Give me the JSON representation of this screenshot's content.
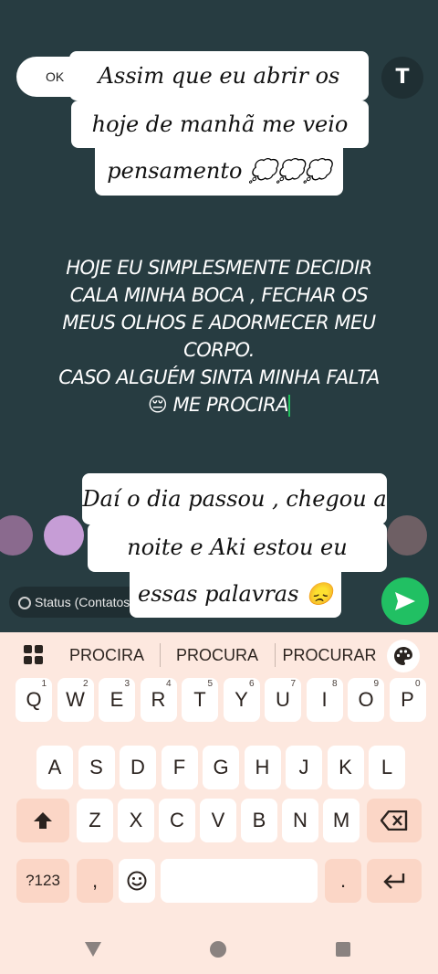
{
  "editor": {
    "ok_label": "OK",
    "text_tool_label": "T",
    "sticker_top": [
      "Assim que eu abrir os olhos",
      "hoje de manhã me veio esse",
      "pensamento 💭💭💭"
    ],
    "main_text": [
      "HOJE EU SIMPLESMENTE DECIDIR",
      "CALA MINHA BOCA , FECHAR OS",
      "MEUS OLHOS E ADORMECER MEU",
      "CORPO.",
      "CASO ALGUÉM SINTA MINHA FALTA",
      "😔 ME PROCIRA"
    ],
    "sticker_bottom": [
      "Daí o dia passou , chegou a",
      "noite e Aki estou eu digitando",
      "essas palavras 😞"
    ],
    "swatch_colors": [
      "#8a6a8e",
      "#c69dd6",
      "#6e5f64"
    ],
    "status_label": "Status (Contatos)",
    "accent": "#21c063"
  },
  "keyboard": {
    "suggestions": [
      "PROCIRA",
      "PROCURA",
      "PROCURAR"
    ],
    "row1": [
      {
        "k": "Q",
        "h": "1"
      },
      {
        "k": "W",
        "h": "2"
      },
      {
        "k": "E",
        "h": "3"
      },
      {
        "k": "R",
        "h": "4"
      },
      {
        "k": "T",
        "h": "5"
      },
      {
        "k": "Y",
        "h": "6"
      },
      {
        "k": "U",
        "h": "7"
      },
      {
        "k": "I",
        "h": "8"
      },
      {
        "k": "O",
        "h": "9"
      },
      {
        "k": "P",
        "h": "0"
      }
    ],
    "row2": [
      "A",
      "S",
      "D",
      "F",
      "G",
      "H",
      "J",
      "K",
      "L"
    ],
    "row3": [
      "Z",
      "X",
      "C",
      "V",
      "B",
      "N",
      "M"
    ],
    "symbols_label": "?123",
    "comma": ",",
    "period": "."
  }
}
